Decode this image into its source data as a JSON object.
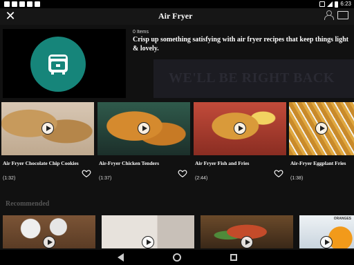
{
  "status_bar": {
    "time": "6:23"
  },
  "header": {
    "title": "Air Fryer"
  },
  "collection": {
    "items_count": "0 Items",
    "description": "Crisp up something satisfying with air fryer recipes that keep things light & lovely."
  },
  "overlay": {
    "text": "WE'LL BE RIGHT BACK"
  },
  "cards": [
    {
      "title": "Air Fryer Chocolate Chip Cookies",
      "duration": "(1:32)"
    },
    {
      "title": "Air-Fryer Chicken Tenders",
      "duration": "(1:37)"
    },
    {
      "title": "Air Fryer Fish and Fries",
      "duration": "(2:44)"
    },
    {
      "title": "Air-Fryer Eggplant Fries",
      "duration": "(1:38)"
    }
  ],
  "recommended": {
    "label": "Recommended",
    "tags": [
      "ORANGES"
    ]
  },
  "icons": {
    "close": "close-icon",
    "cast": "cast-icon",
    "account": "person-icon",
    "heart": "heart-icon",
    "play": "play-icon"
  },
  "colors": {
    "accent": "#16857a",
    "background": "#111111"
  }
}
